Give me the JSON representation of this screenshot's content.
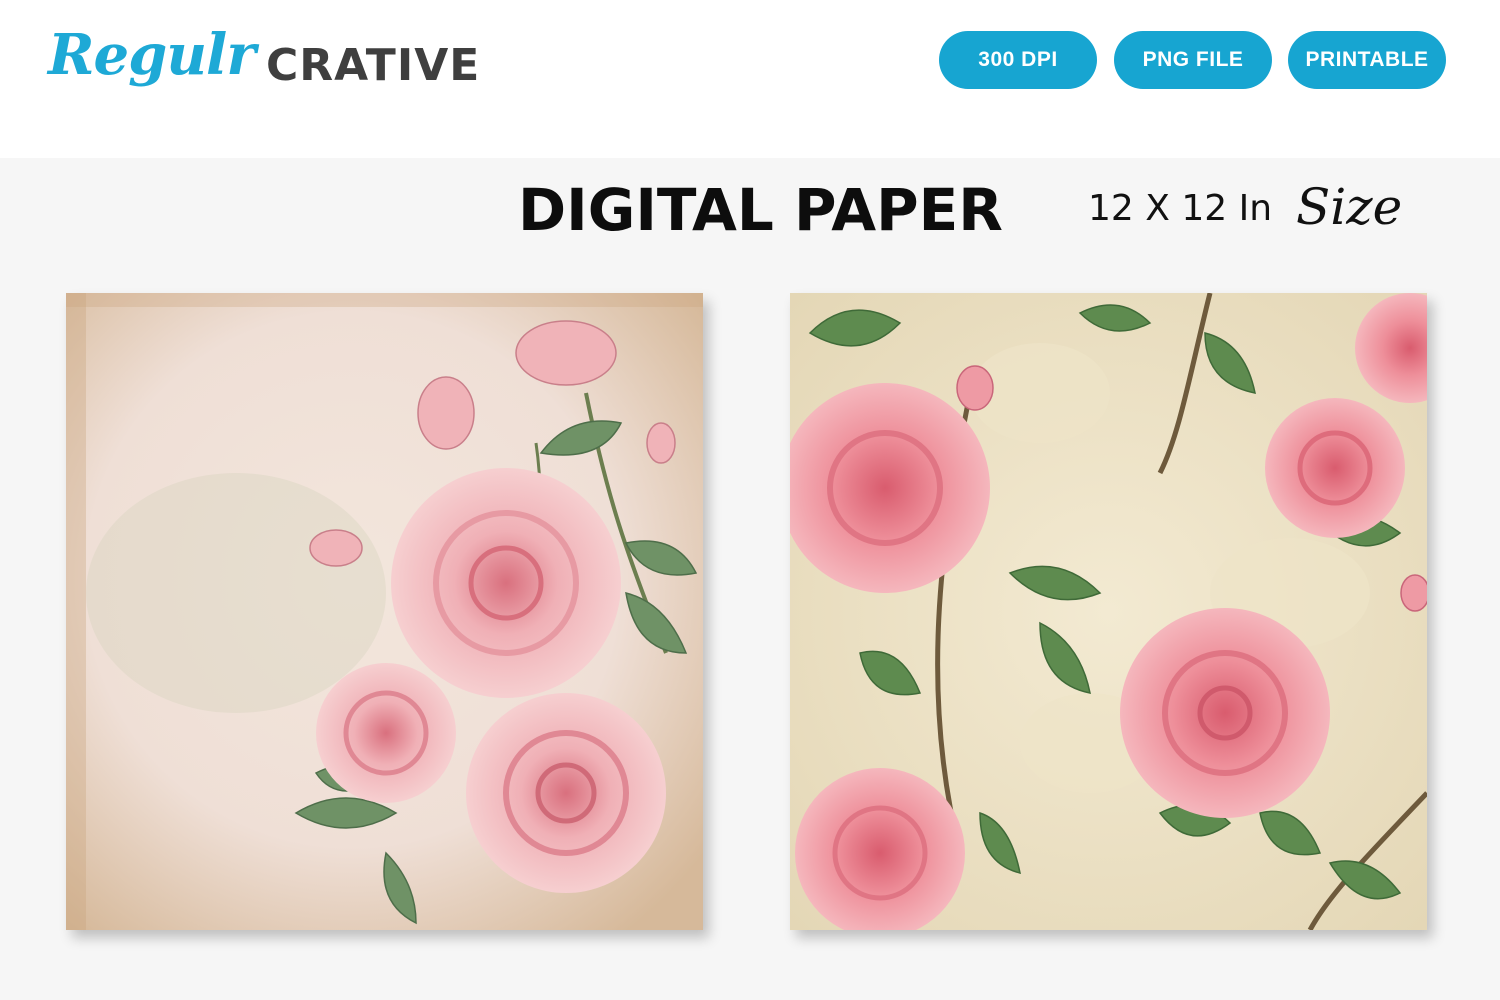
{
  "brand": {
    "logo_script": "Regulr",
    "logo_block": "CRATIVE"
  },
  "badges": [
    "300 DPI",
    "PNG FILE",
    "PRINTABLE"
  ],
  "heading": {
    "title": "DIGITAL PAPER",
    "size_text": "12 X 12 In",
    "size_script": "Size"
  },
  "colors": {
    "badge": "#17a5d1",
    "logo_script": "#1ea9d6",
    "logo_block": "#3f3f3f",
    "rose_light": "#f2b8bd",
    "rose_deep": "#e27a86",
    "leaf": "#5f8a5a"
  }
}
